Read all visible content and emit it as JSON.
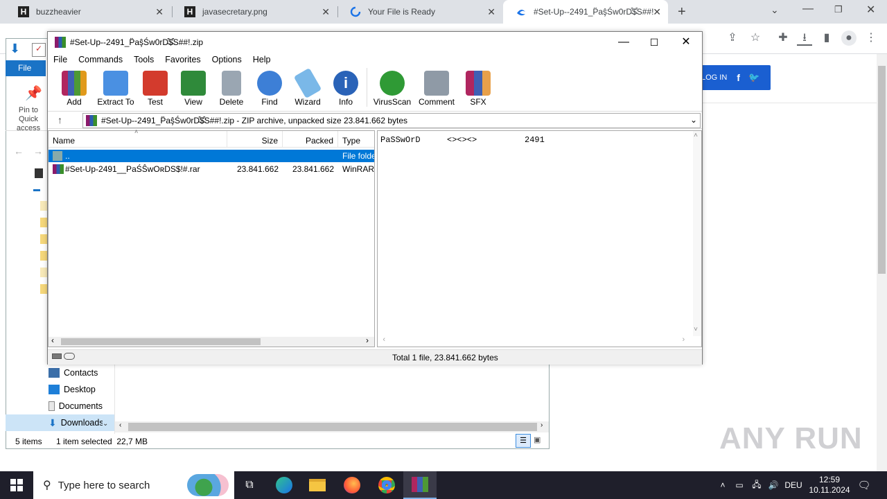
{
  "browser": {
    "tabs": [
      {
        "title": "buzzheavier",
        "icon": "H"
      },
      {
        "title": "javasecretary.png",
        "icon": "H"
      },
      {
        "title": "Your File is Ready",
        "icon": "loading"
      },
      {
        "title": "#Set-Up--2491_P̈aş̂Św0rD̵͒$̵͒S##!",
        "icon": "edge"
      }
    ],
    "login_button": "LOG IN"
  },
  "explorer": {
    "ribbon_tab": "File",
    "pin_label": "Pin to Quick access",
    "nav_items": [
      "Contacts",
      "Desktop",
      "Documents",
      "Downloads"
    ],
    "status_items": "5 items",
    "status_selected": "1 item selected  22,7 MB"
  },
  "winrar": {
    "title": "#Set-Up--2491_P̈aş̂Św0rD̵͒$̵͒S##!.zip",
    "menu": [
      "File",
      "Commands",
      "Tools",
      "Favorites",
      "Options",
      "Help"
    ],
    "toolbar": [
      "Add",
      "Extract To",
      "Test",
      "View",
      "Delete",
      "Find",
      "Wizard",
      "Info",
      "VirusScan",
      "Comment",
      "SFX"
    ],
    "address": "#Set-Up--2491_P̈aş̂Św0rD̵͒$̵͒S##!.zip - ZIP archive, unpacked size 23.841.662 bytes",
    "columns": {
      "name": "Name",
      "size": "Size",
      "packed": "Packed",
      "type": "Type"
    },
    "rows": [
      {
        "name": "..",
        "size": "",
        "packed": "",
        "type": "File folder"
      },
      {
        "name": "#Set-Up-2491__PaŚŜwOʀDS$!#.rar",
        "size": "23.841.662",
        "packed": "23.841.662",
        "type": "WinRAR"
      }
    ],
    "comment": {
      "label": "PaSSwOrD",
      "arrows": "<><><>",
      "code": "2491"
    },
    "status_total": "Total 1 file, 23.841.662 bytes"
  },
  "taskbar": {
    "search_placeholder": "Type here to search",
    "language": "DEU",
    "time": "12:59",
    "date": "10.11.2024"
  },
  "watermark": "ANY RUN"
}
